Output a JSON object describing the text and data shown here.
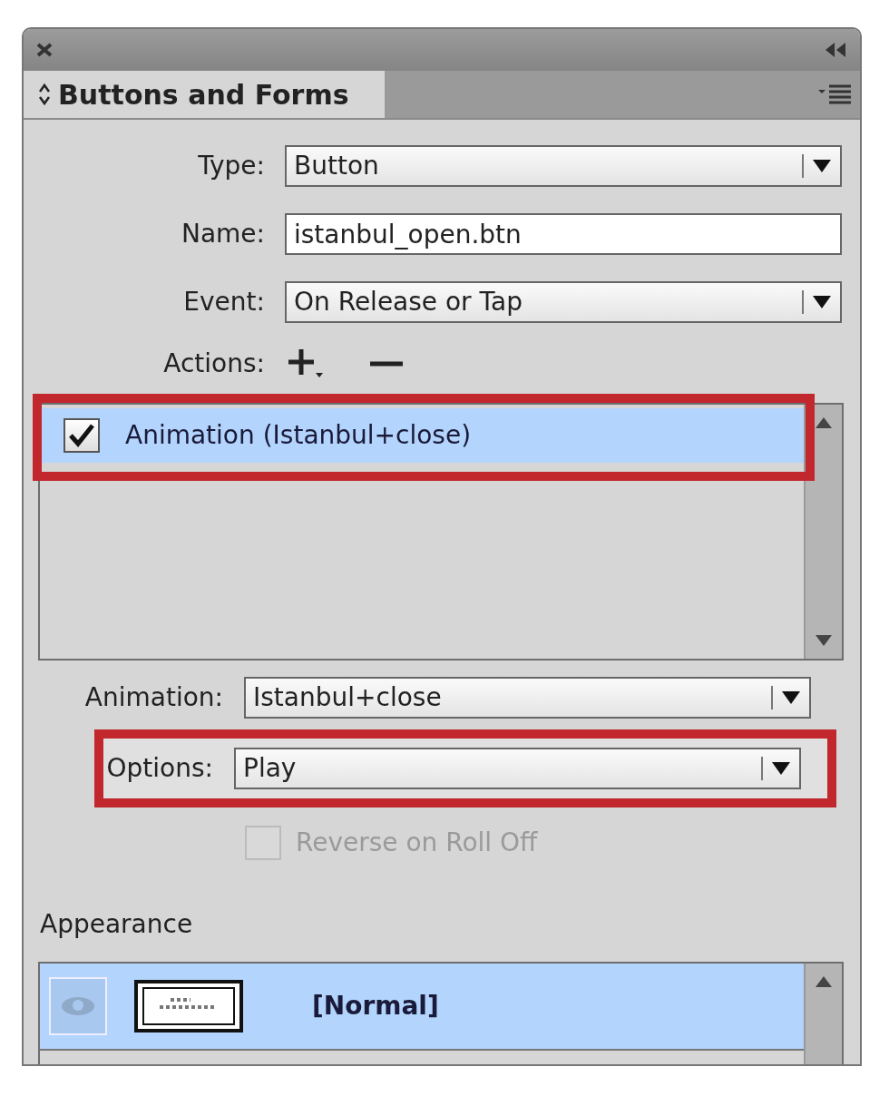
{
  "tab": {
    "label": "Buttons and Forms"
  },
  "fields": [
    {
      "kind": "dropdown",
      "label": "Type:",
      "value": "Button"
    },
    {
      "kind": "text",
      "label": "Name:",
      "value": "istanbul_open.btn"
    },
    {
      "kind": "dropdown",
      "label": "Event:",
      "value": "On Release or Tap"
    }
  ],
  "actions": {
    "label": "Actions:",
    "items": [
      {
        "label": "Animation (Istanbul+close)",
        "checked": true,
        "selected": true,
        "highlighted": true
      }
    ]
  },
  "action_settings": [
    {
      "label": "Animation:",
      "value": "Istanbul+close",
      "highlighted": false
    },
    {
      "label": "Options:",
      "value": "Play",
      "highlighted": true
    }
  ],
  "reverse_option": {
    "label": "Reverse on Roll Off",
    "checked": false,
    "disabled": true
  },
  "appearance": {
    "title": "Appearance",
    "states": [
      {
        "label": "[Normal]",
        "selected": true,
        "visible": true
      }
    ]
  }
}
